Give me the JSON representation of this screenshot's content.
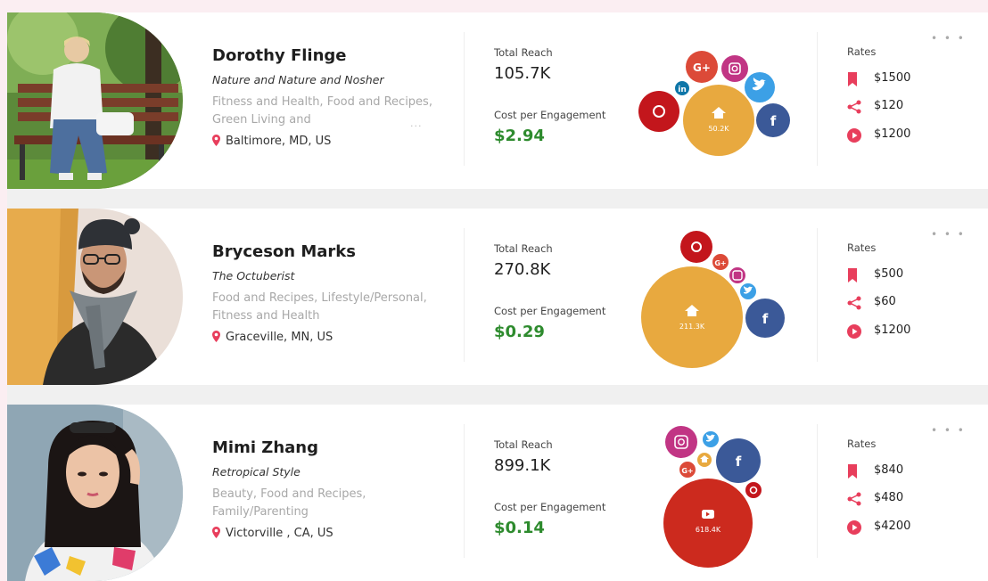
{
  "labels": {
    "total_reach": "Total Reach",
    "cost_per_engagement": "Cost per Engagement",
    "rates": "Rates"
  },
  "colors": {
    "green": "#2e8b2e",
    "pink_accent": "#e83e5c",
    "orange": "#e8a93f",
    "red_youtube": "#cc2a1e",
    "facebook": "#3b5998",
    "twitter": "#3ca0e6",
    "instagram": "#c13584",
    "pinterest": "#c3161c",
    "googleplus": "#dc4a38",
    "linkedin": "#0e76a8"
  },
  "influencers": [
    {
      "name": "Dorothy Flinge",
      "tagline": "Nature and Nature and Nosher",
      "categories": "Fitness and Health, Food and Recipes, Green Living and",
      "more": "...",
      "location": "Baltimore, MD, US",
      "total_reach": "105.7K",
      "cpe": "$2.94",
      "main_bubble": {
        "icon": "home-icon",
        "value": "50.2K"
      },
      "rates": {
        "bookmark": "$1500",
        "share": "$120",
        "video": "$1200"
      }
    },
    {
      "name": "Bryceson Marks",
      "tagline": "The Octuberist",
      "categories": "Food and Recipes, Lifestyle/Personal, Fitness and Health",
      "more": "",
      "location": "Graceville, MN, US",
      "total_reach": "270.8K",
      "cpe": "$0.29",
      "main_bubble": {
        "icon": "home-icon",
        "value": "211.3K"
      },
      "rates": {
        "bookmark": "$500",
        "share": "$60",
        "video": "$1200"
      }
    },
    {
      "name": "Mimi Zhang",
      "tagline": "Retropical Style",
      "categories": "Beauty, Food and Recipes, Family/Parenting",
      "more": "",
      "location": "Victorville , CA, US",
      "total_reach": "899.1K",
      "cpe": "$0.14",
      "main_bubble": {
        "icon": "youtube-icon",
        "value": "618.4K"
      },
      "rates": {
        "bookmark": "$840",
        "share": "$480",
        "video": "$4200"
      }
    }
  ]
}
